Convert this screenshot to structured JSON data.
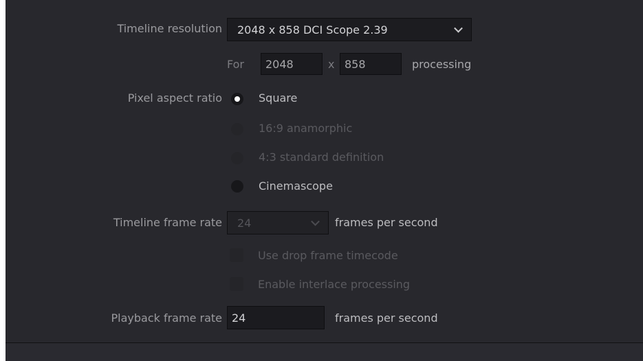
{
  "timeline_resolution": {
    "label": "Timeline resolution",
    "value": "2048 x 858 DCI Scope 2.39"
  },
  "processing": {
    "for_label": "For",
    "width": "2048",
    "x_label": "x",
    "height": "858",
    "suffix": "processing"
  },
  "pixel_aspect_ratio": {
    "label": "Pixel aspect ratio",
    "options": [
      {
        "label": "Square",
        "selected": true,
        "enabled": true
      },
      {
        "label": "16:9 anamorphic",
        "selected": false,
        "enabled": false
      },
      {
        "label": "4:3 standard definition",
        "selected": false,
        "enabled": false
      },
      {
        "label": "Cinemascope",
        "selected": false,
        "enabled": true
      }
    ]
  },
  "timeline_frame_rate": {
    "label": "Timeline frame rate",
    "value": "24",
    "suffix": "frames per second",
    "enabled": false
  },
  "checkboxes": {
    "drop_frame": {
      "label": "Use drop frame timecode",
      "checked": false,
      "enabled": false
    },
    "interlace": {
      "label": "Enable interlace processing",
      "checked": false,
      "enabled": false
    }
  },
  "playback_frame_rate": {
    "label": "Playback frame rate",
    "value": "24",
    "suffix": "frames per second"
  },
  "colors": {
    "panel_bg": "#28282d",
    "field_bg": "#1c1c20",
    "label_text": "#9a9a9e",
    "value_text": "#d2d2d5",
    "disabled_text": "#5a5a5f"
  }
}
